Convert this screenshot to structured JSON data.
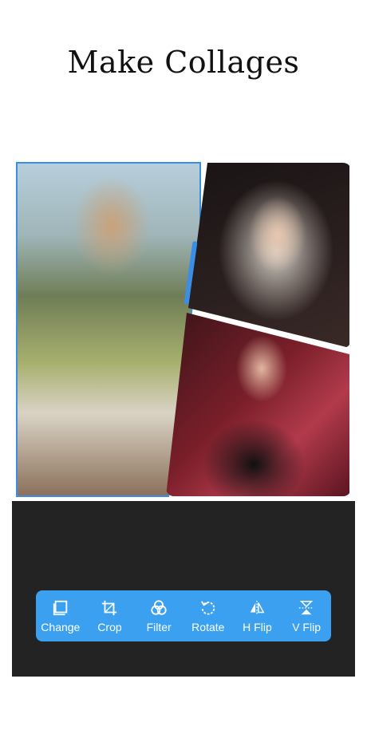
{
  "headline": "Make Collages",
  "toolbar": {
    "items": [
      {
        "label": "Change",
        "icon": "change-icon"
      },
      {
        "label": "Crop",
        "icon": "crop-icon"
      },
      {
        "label": "Filter",
        "icon": "filter-icon"
      },
      {
        "label": "Rotate",
        "icon": "rotate-icon"
      },
      {
        "label": "H Flip",
        "icon": "h-flip-icon"
      },
      {
        "label": "V Flip",
        "icon": "v-flip-icon"
      }
    ]
  },
  "colors": {
    "accent": "#3aa0ef",
    "selection": "#3a8ee6",
    "panel": "#232323",
    "background": "#ffffff"
  }
}
